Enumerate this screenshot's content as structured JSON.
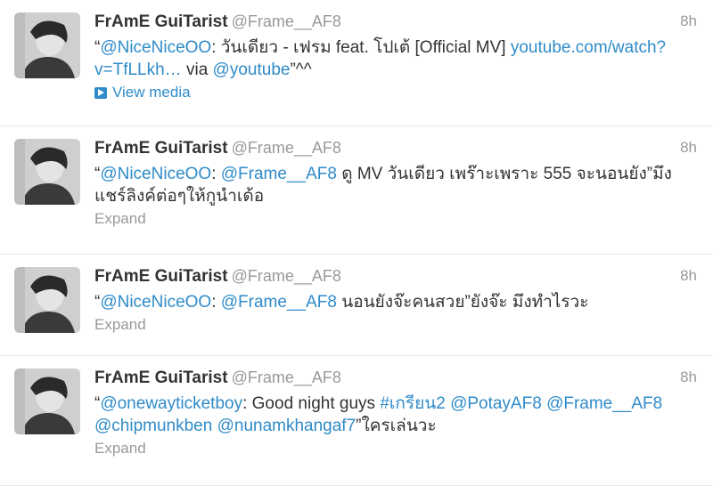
{
  "tweets": [
    {
      "fullname": "FrAmE GuiTarist",
      "username": "@Frame__AF8",
      "time": "8h",
      "parts": [
        {
          "t": "“"
        },
        {
          "t": "@NiceNiceOO",
          "link": true
        },
        {
          "t": ": วันเดียว - เฟรม feat. โปเต้ [Official MV] "
        },
        {
          "t": "youtube.com/watch?v=TfLLkh…",
          "link": true
        },
        {
          "t": " via "
        },
        {
          "t": "@youtube",
          "link": true
        },
        {
          "t": "”^^"
        }
      ],
      "action": "View media",
      "action_icon": "play-icon"
    },
    {
      "fullname": "FrAmE GuiTarist",
      "username": "@Frame__AF8",
      "time": "8h",
      "parts": [
        {
          "t": "“"
        },
        {
          "t": "@NiceNiceOO",
          "link": true
        },
        {
          "t": ": "
        },
        {
          "t": "@Frame__AF8",
          "link": true
        },
        {
          "t": " ดู MV วันเดียว เพร๊าะเพราะ 555 จะนอนยัง”มึงแชร์ลิงค์ต่อๆให้กูนำเด้อ"
        }
      ],
      "action": "Expand"
    },
    {
      "fullname": "FrAmE GuiTarist",
      "username": "@Frame__AF8",
      "time": "8h",
      "parts": [
        {
          "t": "“"
        },
        {
          "t": "@NiceNiceOO",
          "link": true
        },
        {
          "t": ": "
        },
        {
          "t": "@Frame__AF8",
          "link": true
        },
        {
          "t": " นอนยังจ๊ะคนสวย”ยังจ๊ะ มึงทำไรวะ"
        }
      ],
      "action": "Expand"
    },
    {
      "fullname": "FrAmE GuiTarist",
      "username": "@Frame__AF8",
      "time": "8h",
      "parts": [
        {
          "t": "“"
        },
        {
          "t": "@onewayticketboy",
          "link": true
        },
        {
          "t": ": Good night guys "
        },
        {
          "t": "#เกรียน2",
          "link": true
        },
        {
          "t": " "
        },
        {
          "t": "@PotayAF8",
          "link": true
        },
        {
          "t": " "
        },
        {
          "t": "@Frame__AF8",
          "link": true
        },
        {
          "t": " "
        },
        {
          "t": "@chipmunkben",
          "link": true
        },
        {
          "t": " "
        },
        {
          "t": "@nunamkhangaf7",
          "link": true
        },
        {
          "t": "”ใครเล่นวะ"
        }
      ],
      "action": "Expand"
    }
  ],
  "colors": {
    "link": "#2f8bc9",
    "muted": "#999999",
    "text": "#333333",
    "divider": "#e8e8e8"
  }
}
